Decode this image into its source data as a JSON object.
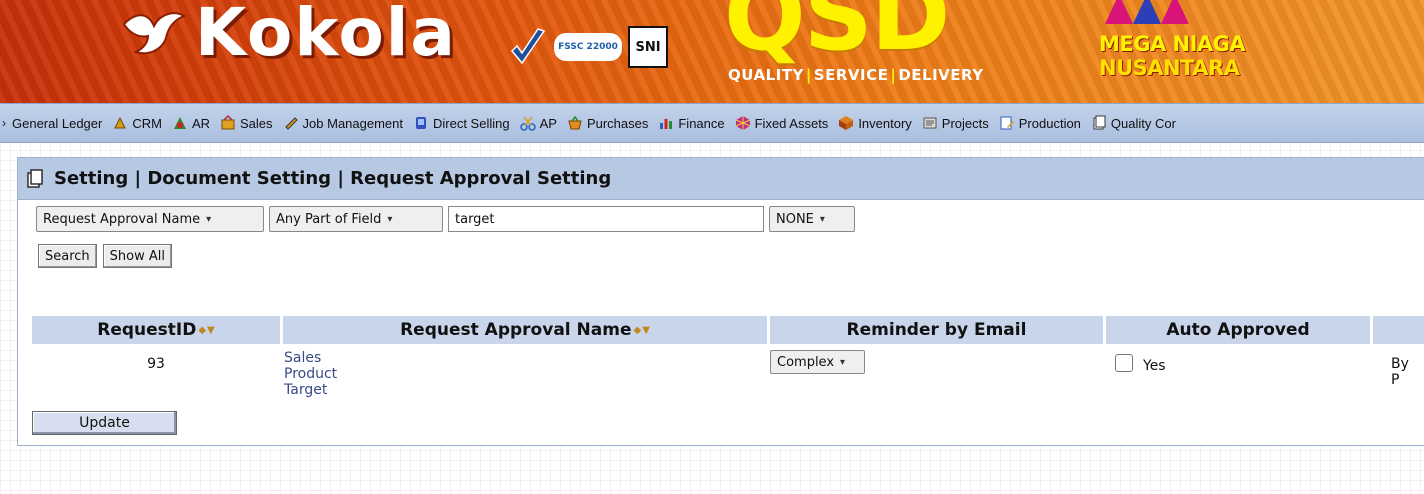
{
  "banner": {
    "brand": "Kokola",
    "cert_fssc": "FSSC 22000",
    "cert_sni": "SNI",
    "qsd": "QSD",
    "tagline": [
      "QUALITY",
      "SERVICE",
      "DELIVERY"
    ],
    "tagline_sep": "|",
    "mega_line1": "MEGA NIAGA",
    "mega_line2": "NUSANTARA"
  },
  "nav": {
    "items": [
      {
        "label": "General Ledger",
        "icon": "arrow-icon"
      },
      {
        "label": "CRM",
        "icon": "crm-icon"
      },
      {
        "label": "AR",
        "icon": "ar-icon"
      },
      {
        "label": "Sales",
        "icon": "sales-icon"
      },
      {
        "label": "Job Management",
        "icon": "job-icon"
      },
      {
        "label": "Direct Selling",
        "icon": "direct-selling-icon"
      },
      {
        "label": "AP",
        "icon": "ap-icon"
      },
      {
        "label": "Purchases",
        "icon": "purchases-icon"
      },
      {
        "label": "Finance",
        "icon": "finance-icon"
      },
      {
        "label": "Fixed Assets",
        "icon": "fixed-assets-icon"
      },
      {
        "label": "Inventory",
        "icon": "inventory-icon"
      },
      {
        "label": "Projects",
        "icon": "projects-icon"
      },
      {
        "label": "Production",
        "icon": "production-icon"
      },
      {
        "label": "Quality Cor",
        "icon": "quality-icon"
      }
    ]
  },
  "page": {
    "title": "Setting | Document Setting | Request Approval Setting"
  },
  "filter": {
    "field_select": "Request Approval Name",
    "match_select": "Any Part of Field",
    "search_value": "target",
    "extra_select": "NONE",
    "search_button": "Search",
    "show_all_button": "Show All"
  },
  "table": {
    "headers": {
      "request_id": "RequestID",
      "request_name": "Request Approval Name",
      "reminder": "Reminder by Email",
      "auto_approved": "Auto Approved"
    },
    "rows": [
      {
        "request_id": "93",
        "request_name": "Sales Product Target",
        "reminder": "Complex",
        "auto_approved_label": "Yes",
        "extra": "By P"
      }
    ]
  },
  "update_button": "Update",
  "colors": {
    "nav_bg": "#b7c8e3",
    "header_bg": "#c9d5ea",
    "link": "#3b4a87"
  }
}
